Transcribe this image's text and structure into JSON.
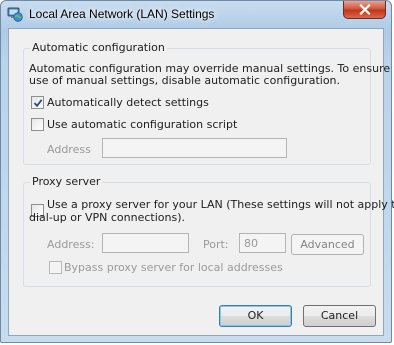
{
  "window": {
    "title": "Local Area Network (LAN) Settings"
  },
  "auto_config": {
    "group_label": "Automatic configuration",
    "description_line1": "Automatic configuration may override manual settings.  To ensure the",
    "description_line2": "use of manual settings, disable automatic configuration.",
    "auto_detect": {
      "label": "Automatically detect settings",
      "checked": true
    },
    "use_script": {
      "label": "Use automatic configuration script",
      "checked": false
    },
    "address_label": "Address",
    "address_value": ""
  },
  "proxy": {
    "group_label": "Proxy server",
    "use_proxy_line1": "Use a proxy server for your LAN (These settings will not apply to",
    "use_proxy_line2": "dial-up or VPN connections).",
    "use_proxy_checked": false,
    "address_label": "Address:",
    "address_value": "",
    "port_label": "Port:",
    "port_value": "80",
    "advanced_label": "Advanced",
    "bypass_label": "Bypass proxy server for local addresses",
    "bypass_checked": false
  },
  "buttons": {
    "ok": "OK",
    "cancel": "Cancel"
  },
  "colors": {
    "checkmark": "#2a4a8a",
    "close_button": "#c7391e",
    "accent": "#3c7fb1"
  }
}
